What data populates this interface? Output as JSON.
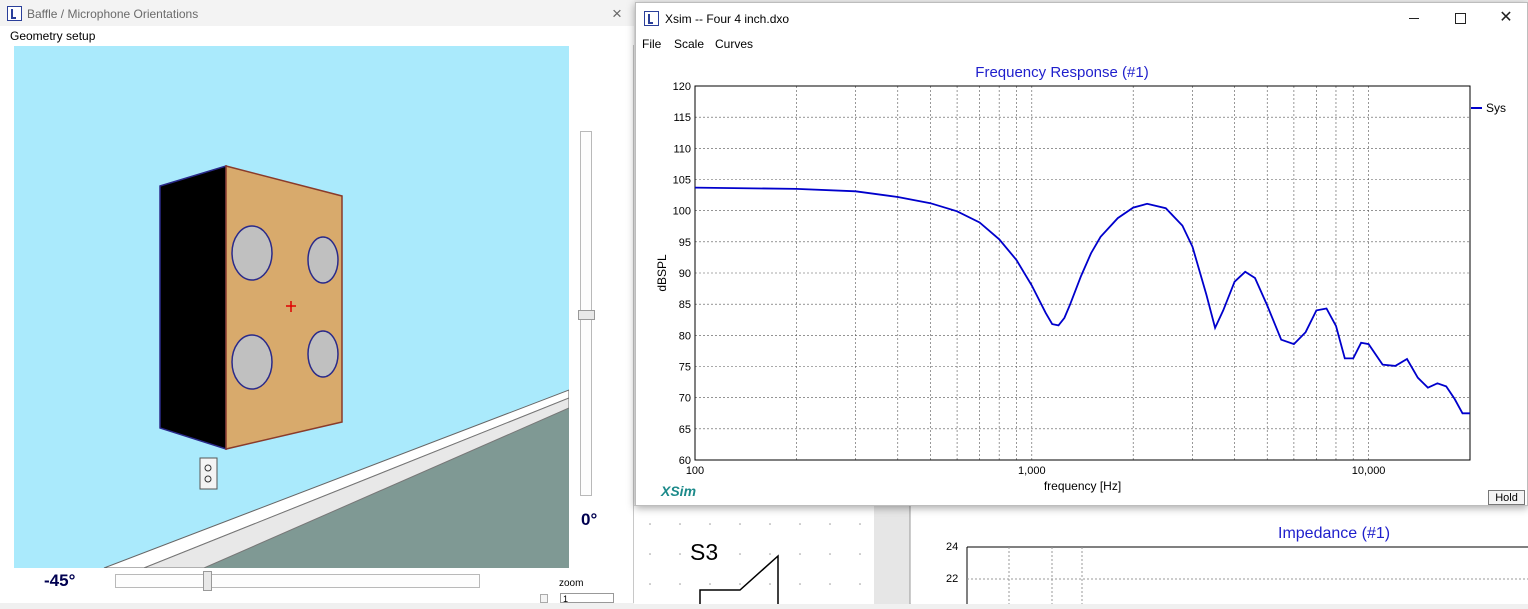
{
  "baffle_window": {
    "title": "Baffle / Microphone Orientations",
    "close_glyph": "×",
    "menu_geometry": "Geometry setup",
    "vertical_angle": "0°",
    "horizontal_angle": "-45°",
    "zoom_label": "zoom",
    "zoom_value": "1"
  },
  "xsim_window": {
    "title": "Xsim -- Four 4 inch.dxo",
    "menu": [
      "File",
      "Scale",
      "Curves"
    ],
    "logo": "XSim",
    "hold_button": "Hold",
    "close_glyph": "✕"
  },
  "chart_data": {
    "type": "line",
    "title": "Frequency Response (#1)",
    "xlabel": "frequency [Hz]",
    "ylabel": "dBSPL",
    "xscale": "log",
    "xlim": [
      100,
      20000
    ],
    "ylim": [
      60,
      120
    ],
    "x_tick_labels": [
      "100",
      "1,000",
      "10,000"
    ],
    "y_ticks": [
      60,
      65,
      70,
      75,
      80,
      85,
      90,
      95,
      100,
      105,
      110,
      115,
      120
    ],
    "grid": true,
    "legend": "right",
    "series_color": "#0000cc",
    "series": [
      {
        "name": "Sys",
        "x": [
          100,
          200,
          300,
          400,
          500,
          600,
          700,
          800,
          900,
          1000,
          1100,
          1150,
          1200,
          1250,
          1300,
          1400,
          1500,
          1600,
          1800,
          2000,
          2200,
          2500,
          2800,
          3000,
          3300,
          3500,
          3700,
          4000,
          4300,
          4600,
          5000,
          5500,
          6000,
          6500,
          7000,
          7500,
          8000,
          8500,
          9000,
          9500,
          10000,
          11000,
          12000,
          13000,
          14000,
          15000,
          16000,
          17000,
          18000,
          19000,
          20000
        ],
        "y": [
          103.7,
          103.5,
          103.1,
          102.2,
          101.2,
          99.9,
          98.1,
          95.4,
          92.1,
          88,
          83.6,
          81.8,
          81.6,
          82.8,
          85,
          89.5,
          93.2,
          95.8,
          98.8,
          100.5,
          101.1,
          100.4,
          97.6,
          94.2,
          86.5,
          81.2,
          84,
          88.6,
          90.2,
          89.2,
          84.8,
          79.3,
          78.6,
          80.5,
          84,
          84.3,
          81.5,
          76.3,
          76.3,
          78.8,
          78.6,
          75.3,
          75.1,
          76.2,
          73.2,
          71.6,
          72.3,
          71.8,
          69.8,
          67.5,
          67.5
        ]
      }
    ]
  },
  "impedance_window": {
    "title": "Impedance (#1)",
    "y_ticks": [
      "24",
      "22"
    ],
    "schematic_label": "S3"
  }
}
